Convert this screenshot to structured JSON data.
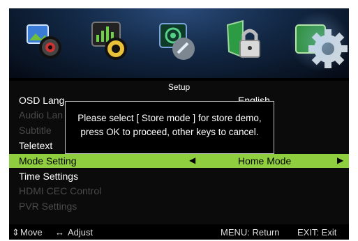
{
  "menu": {
    "title": "Setup",
    "items": [
      {
        "label": "OSD Lang",
        "value": "English",
        "state": "normal"
      },
      {
        "label": "Audio Lan",
        "value": "",
        "state": "dim"
      },
      {
        "label": "Subtitle",
        "value": "",
        "state": "dim"
      },
      {
        "label": "Teletext",
        "value": "",
        "state": "normal"
      },
      {
        "label": "Mode Setting",
        "value": "Home Mode",
        "state": "highlight"
      },
      {
        "label": "Time Settings",
        "value": "",
        "state": "normal"
      },
      {
        "label": "HDMI CEC Control",
        "value": "",
        "state": "dim"
      },
      {
        "label": "PVR Settings",
        "value": "",
        "state": "dim"
      }
    ]
  },
  "dialog": {
    "line1": "Please select [ Store mode ] for store demo,",
    "line2": "press OK to proceed, other keys to cancel."
  },
  "footer": {
    "move": "Move",
    "adjust": "Adjust",
    "menu_return": "MENU: Return",
    "exit": "EXIT: Exit"
  },
  "top_icons": [
    "picture-icon",
    "sound-icon",
    "channel-icon",
    "lock-icon",
    "setup-icon"
  ],
  "colors": {
    "highlight": "#8fcf3f",
    "dialog_border": "#bfbfbf",
    "text": "#ffffff"
  }
}
